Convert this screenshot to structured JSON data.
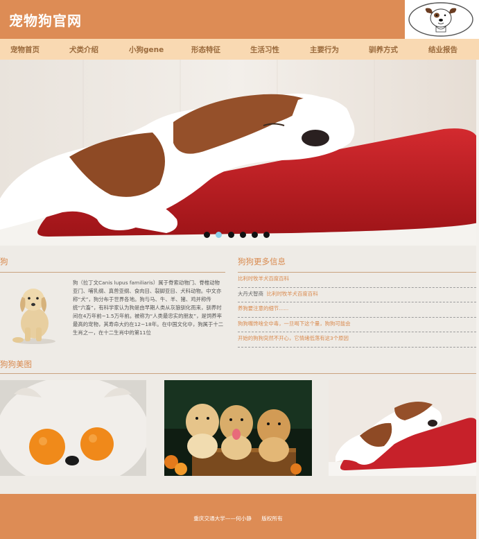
{
  "header": {
    "site_title": "宠物狗官网",
    "logo_alt": "dog-face-logo"
  },
  "nav": {
    "items": [
      {
        "label": "宠物首页"
      },
      {
        "label": "犬类介绍"
      },
      {
        "label": "小狗gene"
      },
      {
        "label": "形态特征"
      },
      {
        "label": "生活习性"
      },
      {
        "label": "主要行为"
      },
      {
        "label": "驯养方式"
      },
      {
        "label": "结业报告"
      }
    ]
  },
  "banner": {
    "dots_count": 6,
    "active_dot": 1
  },
  "intro": {
    "heading": "狗",
    "text": "狗（拉丁文Canis lupus familiaris）属于脊索动物门、脊椎动物亚门、哺乳纲、真兽亚纲、食肉目、裂脚亚目、犬科动物。中文亦称“犬”，狗分布于世界各地。狗与马、牛、羊、猪、鸡并称传统“六畜”，有科学家认为狗是由早期人类从灰狼驯化而来，驯养时间在4万年前~1.5万年前。被称为“人类最忠实的朋友”，是饲养率最高的宠物，其寿命大约在12~18年。在中国文化中，狗属于十二生肖之一，在十二生肖中的第11位"
  },
  "more": {
    "heading": "狗狗更多信息",
    "items": [
      {
        "prefix": "",
        "label": "比利时牧羊犬百度百科"
      },
      {
        "prefix": "大丹犬智商",
        "label": "比利时牧羊犬百度百科"
      },
      {
        "prefix": "",
        "label": "养狗要注意的细节......"
      },
      {
        "prefix": "",
        "label": "狗狗嘴馋啥全中毒，一旦喝下这个量，狗狗可能会"
      },
      {
        "prefix": "",
        "label": "开始的狗狗突然不开心，它情绪低落有这3个原因"
      }
    ]
  },
  "gallery": {
    "heading": "狗狗美图"
  },
  "footer": {
    "text": "重庆交通大学——何小静      版权所有"
  },
  "colors": {
    "header_bg": "#dd8c55",
    "nav_bg": "#f9d9b2",
    "accent_text": "#d98a4e",
    "page_bg": "#eeebe6"
  }
}
